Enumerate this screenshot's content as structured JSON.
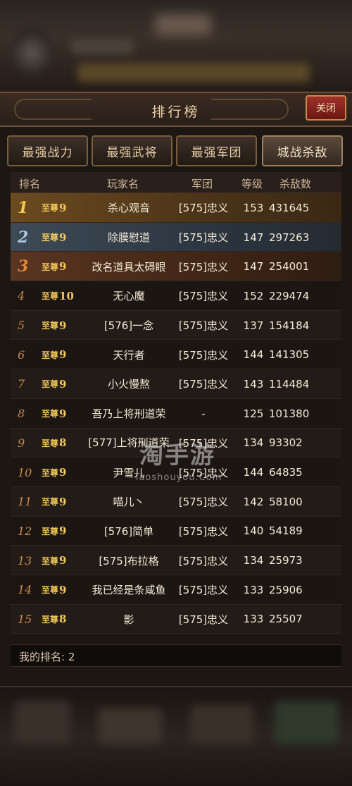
{
  "title": "排行榜",
  "close_label": "关闭",
  "tabs": [
    {
      "label": "最强战力",
      "active": false
    },
    {
      "label": "最强武将",
      "active": false
    },
    {
      "label": "最强军团",
      "active": false
    },
    {
      "label": "城战杀敌",
      "active": true
    }
  ],
  "headers": {
    "rank": "排名",
    "name": "玩家名",
    "legion": "军团",
    "level": "等级",
    "kills": "杀敌数"
  },
  "rows": [
    {
      "rank": "1",
      "vip": "至尊",
      "vip_level": "9",
      "name": "杀心观音",
      "legion": "[575]忠义",
      "level": "153",
      "kills": "431645"
    },
    {
      "rank": "2",
      "vip": "至尊",
      "vip_level": "9",
      "name": "除膜慰道",
      "legion": "[575]忠义",
      "level": "147",
      "kills": "297263"
    },
    {
      "rank": "3",
      "vip": "至尊",
      "vip_level": "9",
      "name": "改名道具太碍眼",
      "legion": "[575]忠义",
      "level": "147",
      "kills": "254001"
    },
    {
      "rank": "4",
      "vip": "至尊",
      "vip_level": "10",
      "name": "无心魔",
      "legion": "[575]忠义",
      "level": "152",
      "kills": "229474"
    },
    {
      "rank": "5",
      "vip": "至尊",
      "vip_level": "9",
      "name": "[576]一念",
      "legion": "[575]忠义",
      "level": "137",
      "kills": "154184"
    },
    {
      "rank": "6",
      "vip": "至尊",
      "vip_level": "9",
      "name": "天行者",
      "legion": "[575]忠义",
      "level": "144",
      "kills": "141305"
    },
    {
      "rank": "7",
      "vip": "至尊",
      "vip_level": "9",
      "name": "小火慢熬",
      "legion": "[575]忠义",
      "level": "143",
      "kills": "114484"
    },
    {
      "rank": "8",
      "vip": "至尊",
      "vip_level": "9",
      "name": "吾乃上将刑道荣",
      "legion": "-",
      "level": "125",
      "kills": "101380"
    },
    {
      "rank": "9",
      "vip": "至尊",
      "vip_level": "8",
      "name": "[577]上将刑道荣",
      "legion": "[575]忠义",
      "level": "134",
      "kills": "93302"
    },
    {
      "rank": "10",
      "vip": "至尊",
      "vip_level": "9",
      "name": "尹雪儿",
      "legion": "[575]忠义",
      "level": "144",
      "kills": "64835"
    },
    {
      "rank": "11",
      "vip": "至尊",
      "vip_level": "9",
      "name": "喵儿丶",
      "legion": "[575]忠义",
      "level": "142",
      "kills": "58100"
    },
    {
      "rank": "12",
      "vip": "至尊",
      "vip_level": "9",
      "name": "[576]简单",
      "legion": "[575]忠义",
      "level": "140",
      "kills": "54189"
    },
    {
      "rank": "13",
      "vip": "至尊",
      "vip_level": "9",
      "name": "[575]布拉格",
      "legion": "[575]忠义",
      "level": "134",
      "kills": "25973"
    },
    {
      "rank": "14",
      "vip": "至尊",
      "vip_level": "9",
      "name": "我已经是条咸鱼",
      "legion": "[575]忠义",
      "level": "133",
      "kills": "25906"
    },
    {
      "rank": "15",
      "vip": "至尊",
      "vip_level": "8",
      "name": "影",
      "legion": "[575]忠义",
      "level": "133",
      "kills": "25507"
    }
  ],
  "my_rank": "我的排名: 2",
  "watermark": {
    "cn": "淘手游",
    "en": "Taoshouyou.Com"
  },
  "colors": {
    "gold": "#f3c84a",
    "silver": "#a9c7e0",
    "bronze": "#e3883a",
    "close_red": "#a0302a"
  }
}
